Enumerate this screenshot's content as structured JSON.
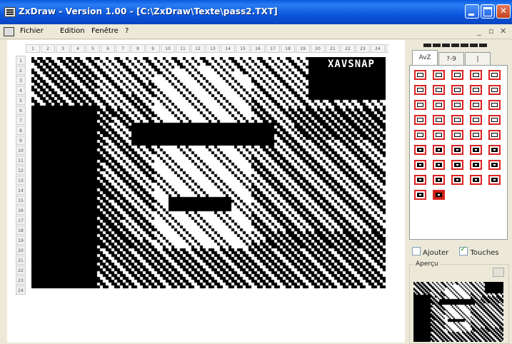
{
  "window": {
    "title": "ZxDraw - Version 1.00 - [C:\\ZxDraw\\Texte\\pass2.TXT]"
  },
  "menu": {
    "items": [
      "Fichier",
      "Edition",
      "Fenêtre",
      "?"
    ]
  },
  "canvas": {
    "banner_text": "XAVSNAP",
    "column_labels": [
      "1",
      "2",
      "3",
      "4",
      "5",
      "6",
      "7",
      "8",
      "9",
      "10",
      "11",
      "12",
      "13",
      "14",
      "15",
      "16",
      "17",
      "18",
      "19",
      "20",
      "21",
      "22",
      "23",
      "24",
      "25",
      "26",
      "27",
      "28",
      "29",
      "30",
      "31",
      "32",
      "33",
      "34"
    ],
    "row_labels": [
      "1",
      "2",
      "3",
      "4",
      "5",
      "6",
      "7",
      "8",
      "9",
      "10",
      "11",
      "12",
      "13",
      "14",
      "15",
      "16",
      "17",
      "18",
      "19",
      "20",
      "21",
      "22",
      "23",
      "24"
    ]
  },
  "panel": {
    "tabs": [
      "AvZ",
      "?-9",
      "|"
    ],
    "palette_columns": 5,
    "palette_count": 42,
    "checkboxes": [
      {
        "label": "Ajouter",
        "checked": false
      },
      {
        "label": "Touches",
        "checked": true
      }
    ],
    "apercu_label": "Aperçu"
  },
  "colors": {
    "titlebar": "#0b58dd",
    "palette_border": "#dd2222",
    "window_bg": "#ece9d8"
  }
}
